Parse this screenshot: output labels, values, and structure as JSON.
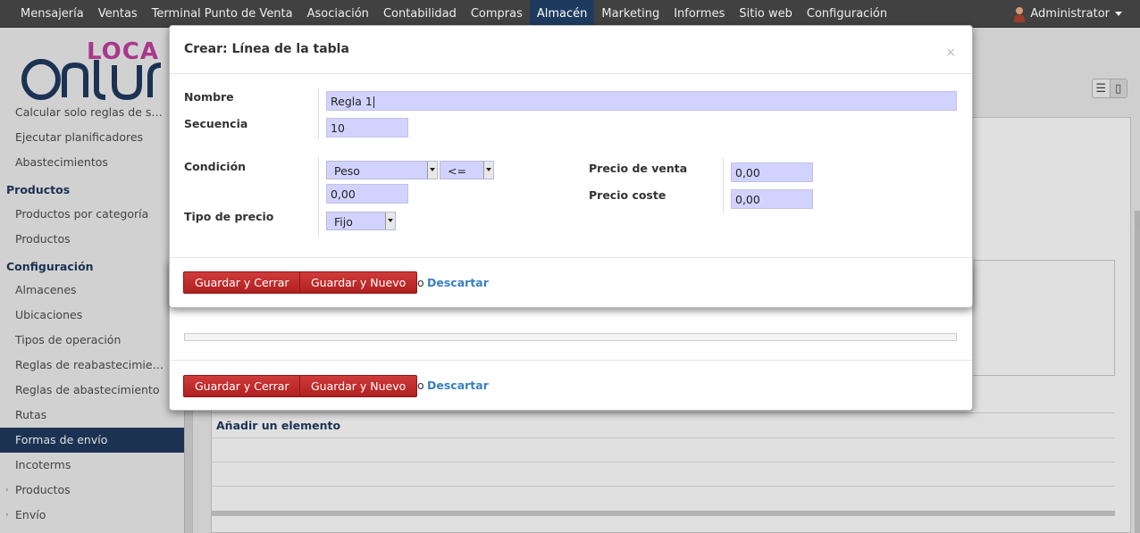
{
  "topbar": {
    "menu": [
      "Mensajería",
      "Ventas",
      "Terminal Punto de Venta",
      "Asociación",
      "Contabilidad",
      "Compras",
      "Almacén",
      "Marketing",
      "Informes",
      "Sitio web",
      "Configuración"
    ],
    "active_menu": "Almacén",
    "user": "Administrator"
  },
  "sidebar": {
    "logo_text": "LOCA",
    "items": [
      {
        "label": "Calcular solo reglas de s…",
        "type": "item"
      },
      {
        "label": "Ejecutar planificadores",
        "type": "item"
      },
      {
        "label": "Abastecimientos",
        "type": "item"
      },
      {
        "label": "Productos",
        "type": "header"
      },
      {
        "label": "Productos por categoría",
        "type": "item"
      },
      {
        "label": "Productos",
        "type": "item"
      },
      {
        "label": "Configuración",
        "type": "header"
      },
      {
        "label": "Almacenes",
        "type": "item"
      },
      {
        "label": "Ubicaciones",
        "type": "item"
      },
      {
        "label": "Tipos de operación",
        "type": "item"
      },
      {
        "label": "Reglas de reabastecimie…",
        "type": "item"
      },
      {
        "label": "Reglas de abastecimiento",
        "type": "item"
      },
      {
        "label": "Rutas",
        "type": "item"
      },
      {
        "label": "Formas de envío",
        "type": "item",
        "selected": true
      },
      {
        "label": "Incoterms",
        "type": "item"
      },
      {
        "label": "Productos",
        "type": "item",
        "expandable": true
      },
      {
        "label": "Envío",
        "type": "item",
        "expandable": true
      }
    ]
  },
  "background": {
    "add_element": "Añadir un elemento",
    "footer": {
      "save_close": "Guardar y Cerrar",
      "save_new": "Guardar y Nuevo",
      "or": "o",
      "discard": "Descartar"
    }
  },
  "dialog": {
    "title": "Crear: Línea de la tabla",
    "close_icon": "×",
    "fields": {
      "nombre_label": "Nombre",
      "nombre_value": "Regla 1",
      "secuencia_label": "Secuencia",
      "secuencia_value": "10",
      "condicion_label": "Condición",
      "condicion_variable": "Peso",
      "condicion_operator": "<=",
      "condicion_value": "0,00",
      "tipo_precio_label": "Tipo de precio",
      "tipo_precio_value": "Fijo",
      "precio_venta_label": "Precio de venta",
      "precio_venta_value": "0,00",
      "precio_coste_label": "Precio coste",
      "precio_coste_value": "0,00"
    },
    "footer": {
      "save_close": "Guardar y Cerrar",
      "save_new": "Guardar y Nuevo",
      "or": "o",
      "discard": "Descartar"
    }
  }
}
